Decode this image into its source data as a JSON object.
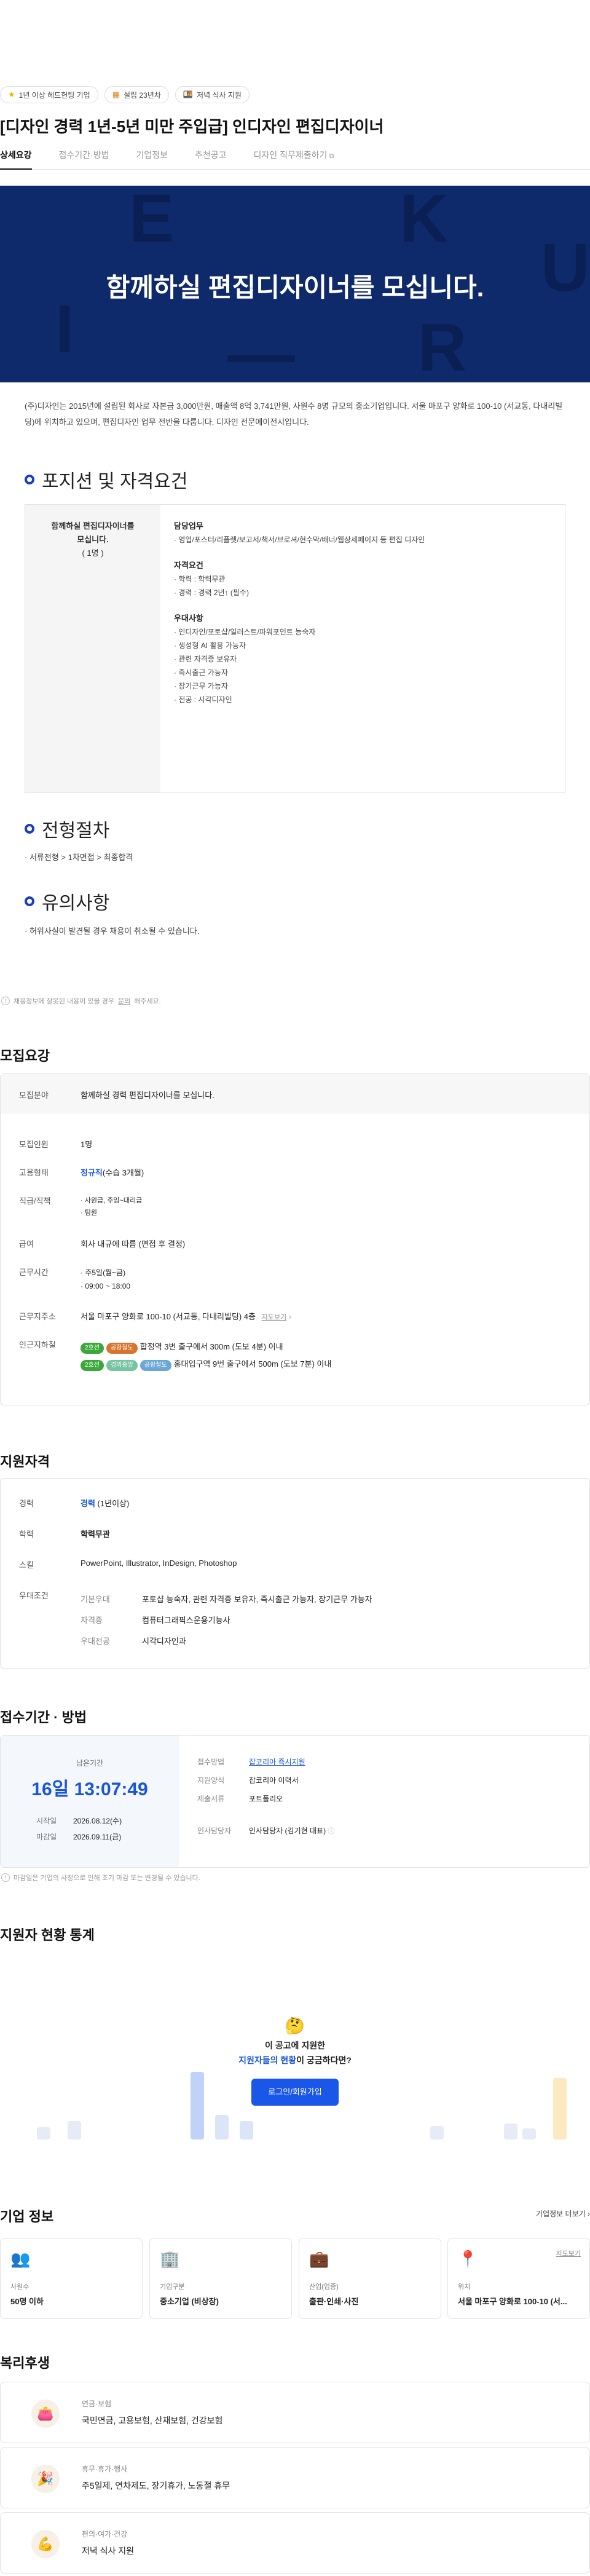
{
  "chips": [
    {
      "icon": "star-icon",
      "glyph": "★",
      "label": "1년 이상 헤드헌팅 기업"
    },
    {
      "icon": "building-icon",
      "glyph": "▦",
      "label": "설립 23년차"
    },
    {
      "icon": "meal-icon",
      "glyph": "🍱",
      "label": "저녁 식사 지원"
    }
  ],
  "title": "[디자인 경력 1년-5년 미만 주입급] 인디자인 편집디자이너",
  "tabs": [
    "상세요강",
    "접수기간·방법",
    "기업정보",
    "추천공고",
    "디자인 직무제출하기"
  ],
  "banner": {
    "headline": "함께하실 편집디자이너를 모십니다.",
    "letters": [
      "E",
      "K",
      "U",
      "I",
      "R",
      "—"
    ]
  },
  "intro": "(주)디자인는 2015년에 설립된 회사로 자본금 3,000만원, 매출액 8억 3,741만원, 사원수 8명 규모의 중소기업입니다. 서울 마포구 양화로 100-10 (서교동, 다내리빌딩)에 위치하고 있으며, 편집디자인 업무 전반을 다룹니다. 디자인 전문에이전시입니다.",
  "position": {
    "heading": "포지션 및 자격요건",
    "role": "함께하실 편집디자이너를 모십니다.",
    "count": "( 1명 )",
    "groups": [
      {
        "title": "담당업무",
        "items": [
          "· 영업/포스터/리플렛/보고서/책서/브로셔/현수막/배너/웹상세페이지 등 편집 디자인"
        ]
      },
      {
        "title": "자격요건",
        "items": [
          "· 학력 : 학력무관",
          "· 경력 : 경력 2년↑ (필수)"
        ]
      },
      {
        "title": "우대사항",
        "items": [
          "· 인디자인/포토샵/일러스트/파워포인트 능숙자",
          "· 생성형 AI 활용 가능자",
          "· 관련 자격증 보유자",
          "· 즉시출근 가능자",
          "· 장기근무 가능자",
          "· 전공 : 시각디자인"
        ]
      }
    ]
  },
  "process": {
    "heading": "전형절차",
    "text": "· 서류전형 > 1차면접 > 최종합격"
  },
  "caution": {
    "heading": "유의사항",
    "text": "· 허위사실이 발견될 경우 채용이 취소될 수 있습니다."
  },
  "notice": {
    "text": "채용정보에 잘못된 내용이 있을 경우",
    "link": "문의",
    "suffix": "해주세요."
  },
  "recruit": {
    "heading": "모집요강",
    "field_label": "모집분야",
    "field_value": "함께하실 경력 편집디자이너를 모십니다.",
    "people_label": "모집인원",
    "people_value": "1명",
    "type_label": "고용형태",
    "type_value": "정규직",
    "type_sub": "(수습 3개월)",
    "rank_label": "직급/직책",
    "rank_items": [
      "· 사원급, 주임~대리급",
      "· 팀원"
    ],
    "pay_label": "급여",
    "pay_value": "회사 내규에 따름 (면접 후 결정)",
    "time_label": "근무시간",
    "time_items": [
      "· 주5일(월~금)",
      "· 09:00 ~ 18:00"
    ],
    "addr_label": "근무지주소",
    "addr_value": "서울 마포구 양화로 100-10 (서교동, 다내리빌딩) 4층",
    "addr_link": "지도보기",
    "subway_label": "인근지하철",
    "subway_rows": [
      {
        "tags": [
          {
            "t": "2호선",
            "c": "#3aa93a"
          },
          {
            "t": "공항철도",
            "c": "#6aa6d6"
          }
        ],
        "text": "합정역 3번 출구에서 300m (도보 4분) 이내"
      },
      {
        "tags": [
          {
            "t": "2호선",
            "c": "#3aa93a"
          },
          {
            "t": "경의중앙",
            "c": "#77c4a3"
          },
          {
            "t": "공항철도",
            "c": "#6aa6d6"
          }
        ],
        "text": "홍대입구역 9번 출구에서 500m (도보 7분) 이내"
      }
    ]
  },
  "qual": {
    "heading": "지원자격",
    "career_label": "경력",
    "career_value": "경력",
    "career_sub": "(1년이상)",
    "edu_label": "학력",
    "edu_value": "학력무관",
    "skill_label": "스킬",
    "skill_value": "PowerPoint, Illustrator, InDesign, Photoshop",
    "pref_label": "우대조건",
    "pref_rows": [
      {
        "k": "기본우대",
        "v": "포토샵 능숙자, 관련 자격증 보유자, 즉시출근 가능자, 장기근무 가능자"
      },
      {
        "k": "자격증",
        "v": "컴퓨터그래픽스운용기능사"
      },
      {
        "k": "우대전공",
        "v": "시각디자인과"
      }
    ]
  },
  "apply": {
    "heading": "접수기간 · 방법",
    "remain_label": "남은기간",
    "remain_value": "16일 13:07:49",
    "start_label": "시작일",
    "start_value": "2026.08.12(수)",
    "end_label": "마감일",
    "end_value": "2026.09.11(금)",
    "method_label": "접수방법",
    "method_value": "잡코리아 즉시지원",
    "form_label": "지원양식",
    "form_value": "잡코리아 이력서",
    "docs_label": "제출서류",
    "docs_value": "포트폴리오",
    "contact_label": "인사담당자",
    "contact_value": "인사담당자 (김기현 대표)",
    "footnote": "마감일은 기업의 사정으로 인해 조기 마감 또는 변경될 수 있습니다."
  },
  "stats": {
    "heading": "지원자 현황 통계",
    "question_a": "이 공고에 지원한",
    "question_b": "지원자들의 현황",
    "question_c": "이 궁금하다면?",
    "login_label": "로그인/회원가입"
  },
  "company": {
    "heading": "기업 정보",
    "more": "기업정보 더보기 ›",
    "cards": [
      {
        "icon": "people-icon",
        "glyph": "👥",
        "label": "사원수",
        "value": "50명 이하"
      },
      {
        "icon": "office-icon",
        "glyph": "🏢",
        "label": "기업구분",
        "value": "중소기업 (비상장)"
      },
      {
        "icon": "briefcase-icon",
        "glyph": "💼",
        "label": "산업(업종)",
        "value": "출판·인쇄·사진"
      },
      {
        "icon": "location-icon",
        "glyph": "📍",
        "label": "위치",
        "value": "서울 마포구 양화로 100-10 (서...",
        "link": "지도보기"
      }
    ]
  },
  "welfare": {
    "heading": "복리후생",
    "items": [
      {
        "icon": "pension-icon",
        "glyph": "👛",
        "title": "연금·보험",
        "value": "국민연금, 고용보험, 산재보험, 건강보험"
      },
      {
        "icon": "party-icon",
        "glyph": "🎉",
        "title": "휴무·휴가·행사",
        "value": "주5일제, 연차제도, 장기휴가, 노동절 휴무"
      },
      {
        "icon": "muscle-icon",
        "glyph": "💪",
        "title": "편의·여가·건강",
        "value": "저녁 식사 지원"
      }
    ]
  }
}
